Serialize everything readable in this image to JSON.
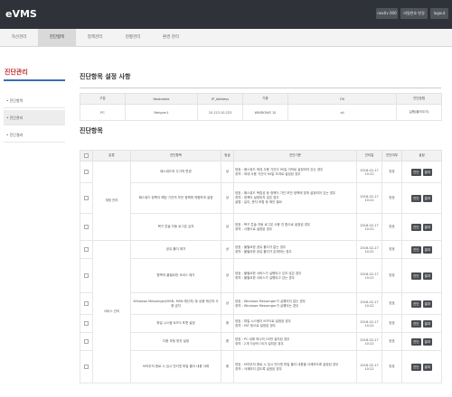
{
  "app": {
    "logo": "eVMS",
    "top_buttons": [
      "nextlv 000",
      "비밀번호 변경",
      "logout"
    ]
  },
  "menu": [
    "자산관리",
    "진단항목",
    "정책관리",
    "현황관리",
    "환경 관리"
  ],
  "sidebar": {
    "title": "진단관리",
    "items": [
      "• 진단항목",
      "• 진단관리",
      "• 진단결과"
    ]
  },
  "setting_section": {
    "title": "진단항목 설정 사항",
    "columns": [
      "구분",
      "Hostname",
      "IP_Address",
      "기종",
      "OS",
      "진단방법"
    ],
    "row": [
      "PC",
      "Netgum1",
      "10.123.10.223",
      "WINDOWS 10",
      "all",
      "실행(불러오기)"
    ]
  },
  "items_section": {
    "title": "진단항목",
    "columns": [
      "",
      "분류",
      "진단항목",
      "등급",
      "진단기준",
      "관리일",
      "진단여부",
      "설정"
    ],
    "groups": [
      "계정 관리",
      "서비스 관리"
    ],
    "rows": [
      {
        "item": "패스워드의 주기적 변경",
        "grade": "상",
        "criteria": "양호 : 패스워드 최대 사용 기간이 90일 이하로 설정되어 있는 경우\n취약 : 최대 사용 기간이 90일 초과로 설정된 경우",
        "date": "2016-02-17\n10:22",
        "status": "양호"
      },
      {
        "item": "패스워드 정책이 해당 기관의 보안 정책에 적합하게 설정",
        "grade": "상",
        "criteria": "양호 : 패스워드 복잡성 등 정책이 기관 보안 정책에 맞게 설정되어 있는 경우\n취약 : 정책이 설정되지 않은 경우\n설명 : 길이, 문자 조합 등 확인 필요",
        "date": "2016-02-17\n10:22",
        "status": "양호"
      },
      {
        "item": "복구 콘솔 자동 로그온 금지",
        "grade": "상",
        "criteria": "양호 : 복구 콘솔 자동 로그온 사용 안 함으로 설정된 경우\n취약 : 사용으로 설정된 경우",
        "date": "2016-02-17\n10:22",
        "status": "양호"
      },
      {
        "item": "공유 폴더 제거",
        "grade": "상",
        "criteria": "양호 : 불필요한 공유 폴더가 없는 경우\n취약 : 불필요한 공유 폴더가 존재하는 경우",
        "date": "2016-02-17\n10:22",
        "status": "양호"
      },
      {
        "item": "항목의 불필요한 서비스 제거",
        "grade": "상",
        "criteria": "양호 : 불필요한 서비스가 실행되고 있지 않은 경우\n취약 : 불필요한 서비스가 실행되고 있는 경우",
        "date": "2016-02-17\n10:22",
        "status": "양호"
      },
      {
        "item": "Windows Messenger(MSN, MSN 메신저) 등 상용 메신저 사용 금지",
        "grade": "상",
        "criteria": "양호 : Windows Messenger가 실행되지 않는 경우\n취약 : Windows Messenger가 실행되는 경우",
        "date": "2016-02-17\n10:22",
        "status": "양호"
      },
      {
        "item": "파일 시스템 NTFS 포맷 설정",
        "grade": "중",
        "criteria": "양호 : 파일 시스템이 NTFS로 설정된 경우\n취약 : FAT 등으로 설정된 경우",
        "date": "2016-02-17\n10:22",
        "status": "양호"
      },
      {
        "item": "다중 부팅 방지 설정",
        "grade": "중",
        "criteria": "양호 : PC 내에 하나의 OS만 설치된 경우\n취약 : 2개 이상의 OS가 설치된 경우",
        "date": "2016-02-17\n10:22",
        "status": "양호"
      },
      {
        "item": "브라우저 종료 시 임시 인터넷 파일 폴더 내용 삭제",
        "grade": "중",
        "criteria": "양호 : 브라우저 종료 시 임시 인터넷 파일 폴더 내용을 삭제하도록 설정된 경우\n취약 : 삭제하지 않도록 설정된 경우",
        "date": "2016-02-17\n10:22",
        "status": "양호"
      }
    ],
    "action_buttons": [
      "진단",
      "결과"
    ]
  }
}
